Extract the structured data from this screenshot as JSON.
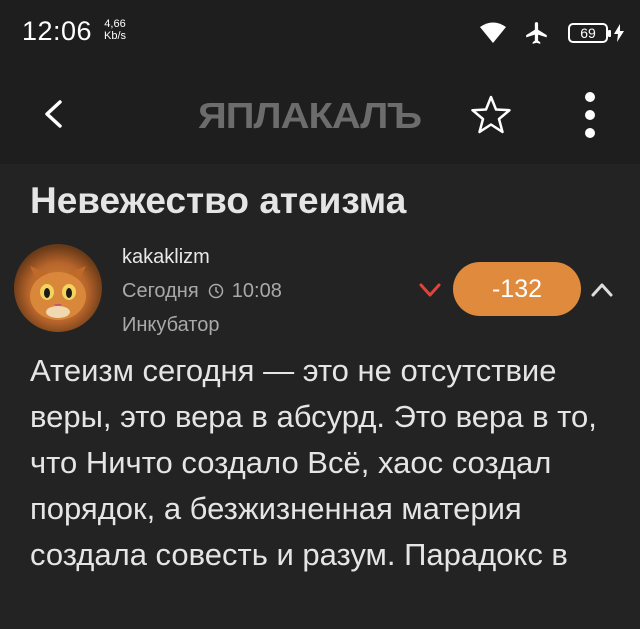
{
  "status_bar": {
    "time": "12:06",
    "net_speed_value": "4,66",
    "net_speed_unit": "Kb/s",
    "battery": "69",
    "icons": [
      "wifi-icon",
      "airplane-icon",
      "battery-icon",
      "charging-icon"
    ]
  },
  "toolbar": {
    "logo": "ЯПЛАКАЛЪ",
    "icons": [
      "back-icon",
      "star-icon",
      "more-vert-icon"
    ]
  },
  "post": {
    "title": "Невежество атеизма",
    "author": "kakaklizm",
    "date": "Сегодня",
    "time": "10:08",
    "rank": "Инкубатор",
    "rating": "-132",
    "body": "Атеизм сегодня — это не отсутствие веры, это вера в абсурд. Это вера в то, что Ничто создало Всё, хаос создал порядок, а безжизненная материя создала совесть и разум. Парадокс в"
  },
  "colors": {
    "background": "#232323",
    "bar": "#1e1e1e",
    "rating_badge": "#df8a3c",
    "vote_down": "#e0433d"
  }
}
